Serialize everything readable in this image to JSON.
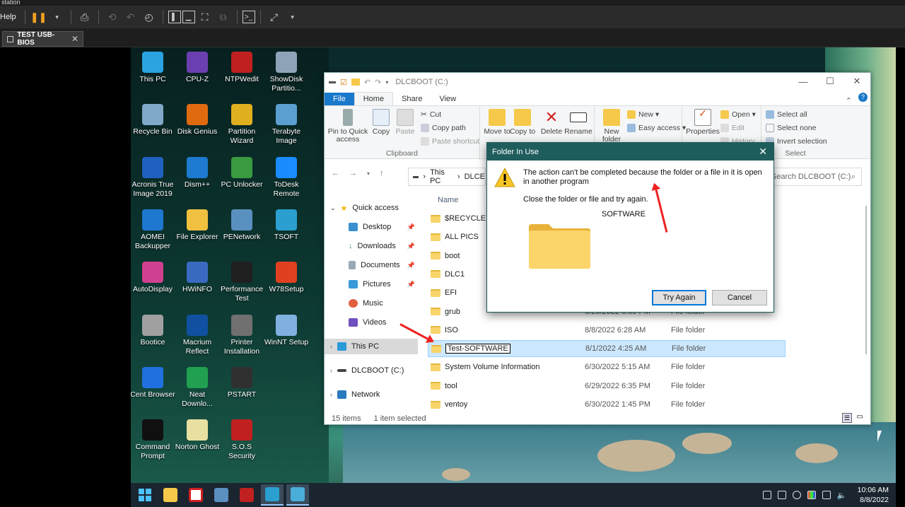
{
  "host": {
    "title_fragment": "station",
    "menu_help": "Help",
    "vm_tab": "TEST USB-BIOS",
    "vm_tab_close": "✕"
  },
  "desktop_icons": [
    {
      "label": "This PC",
      "icon": "monitor-icon",
      "color": "#2aa3e0"
    },
    {
      "label": "CPU-Z",
      "icon": "chip-icon",
      "color": "#6b3fb0"
    },
    {
      "label": "NTPWedit",
      "icon": "ntpw-icon",
      "color": "#c02020"
    },
    {
      "label": "ShowDisk Partitio...",
      "icon": "disk-search-icon",
      "color": "#8fa3b8"
    },
    {
      "label": "Recycle Bin",
      "icon": "recycle-bin-icon",
      "color": "#7fa8c9"
    },
    {
      "label": "Disk Genius",
      "icon": "diskgenius-icon",
      "color": "#e06a10"
    },
    {
      "label": "Partition Wizard",
      "icon": "partition-wizard-icon",
      "color": "#e0b020"
    },
    {
      "label": "Terabyte Image",
      "icon": "terabyte-icon",
      "color": "#5a9fd0"
    },
    {
      "label": "Acronis True Image 2019",
      "icon": "acronis-icon",
      "color": "#2060c0"
    },
    {
      "label": "Dism++",
      "icon": "gears-icon",
      "color": "#1e7ad0"
    },
    {
      "label": "PC Unlocker",
      "icon": "pc-unlocker-icon",
      "color": "#3a9a40"
    },
    {
      "label": "ToDesk Remote",
      "icon": "todesk-icon",
      "color": "#1a8cff"
    },
    {
      "label": "AOMEI Backupper",
      "icon": "aomei-icon",
      "color": "#1e78d0"
    },
    {
      "label": "File Explorer",
      "icon": "folder-icon",
      "color": "#f0c040"
    },
    {
      "label": "PENetwork",
      "icon": "network-icon",
      "color": "#5a90c0"
    },
    {
      "label": "TSOFT",
      "icon": "tsoft-icon",
      "color": "#2a9fd0"
    },
    {
      "label": "AutoDisplay",
      "icon": "display-icon",
      "color": "#d04090"
    },
    {
      "label": "HWiNFO",
      "icon": "hwinfo-icon",
      "color": "#3a6ac0"
    },
    {
      "label": "Performance Test",
      "icon": "performance-icon",
      "color": "#202020"
    },
    {
      "label": "W78Setup",
      "icon": "windows-setup-icon",
      "color": "#e04020"
    },
    {
      "label": "Bootice",
      "icon": "bootice-icon",
      "color": "#a0a0a0"
    },
    {
      "label": "Macrium Reflect",
      "icon": "macrium-icon",
      "color": "#1050a0"
    },
    {
      "label": "Printer Installation",
      "icon": "printer-icon",
      "color": "#707070"
    },
    {
      "label": "WinNT Setup",
      "icon": "winnt-icon",
      "color": "#80b0e0"
    },
    {
      "label": "Cent Browser",
      "icon": "browser-icon",
      "color": "#2070e0"
    },
    {
      "label": "Neat Downlo...",
      "icon": "neat-download-icon",
      "color": "#20a050"
    },
    {
      "label": "PSTART",
      "icon": "play-icon",
      "color": "#303030"
    },
    {
      "label": "",
      "icon": "",
      "color": ""
    },
    {
      "label": "Command Prompt",
      "icon": "cmd-icon",
      "color": "#101010"
    },
    {
      "label": "Norton Ghost",
      "icon": "ghost-icon",
      "color": "#e8e0a0"
    },
    {
      "label": "S.O.S Security",
      "icon": "sos-icon",
      "color": "#c02020"
    }
  ],
  "explorer": {
    "title": "DLCBOOT (C:)",
    "tabs": [
      "File",
      "Home",
      "Share",
      "View"
    ],
    "ribbon": {
      "pin_label": "Pin to Quick access",
      "copy_label": "Copy",
      "paste_label": "Paste",
      "cut_label": "Cut",
      "copy_path_label": "Copy path",
      "paste_shortcut_label": "Paste shortcut",
      "clipboard_group": "Clipboard",
      "move_to_label": "Move to",
      "copy_to_label": "Copy to",
      "delete_label": "Delete",
      "rename_label": "Rename",
      "new_folder_label": "New folder",
      "new_item_label": "New ▾",
      "easy_access_label": "Easy access ▾",
      "properties_label": "Properties",
      "open_label": "Open ▾",
      "edit_label": "Edit",
      "history_label": "History",
      "select_all_label": "Select all",
      "select_none_label": "Select none",
      "invert_label": "Invert selection",
      "select_group": "Select"
    },
    "address": [
      "This PC",
      "DLCE"
    ],
    "search_placeholder": "Search DLCBOOT (C:)",
    "nav": {
      "quick_access": "Quick access",
      "desktop": "Desktop",
      "downloads": "Downloads",
      "documents": "Documents",
      "pictures": "Pictures",
      "music": "Music",
      "videos": "Videos",
      "this_pc": "This PC",
      "dlcboot": "DLCBOOT (C:)",
      "network": "Network"
    },
    "column_name": "Name",
    "files": [
      {
        "name": "$RECYCLE.BIN",
        "date": "",
        "type": ""
      },
      {
        "name": "ALL PICS",
        "date": "",
        "type": ""
      },
      {
        "name": "boot",
        "date": "",
        "type": ""
      },
      {
        "name": "DLC1",
        "date": "",
        "type": ""
      },
      {
        "name": "EFI",
        "date": "",
        "type": ""
      },
      {
        "name": "grub",
        "date": "6/29/2022 6:09 PM",
        "type": "File folder"
      },
      {
        "name": "ISO",
        "date": "8/8/2022 6:28 AM",
        "type": "File folder"
      },
      {
        "name": "Test-SOFTWARE",
        "date": "8/1/2022 4:25 AM",
        "type": "File folder"
      },
      {
        "name": "System Volume Information",
        "date": "6/30/2022 5:15 AM",
        "type": "File folder"
      },
      {
        "name": "tool",
        "date": "6/29/2022 6:35 PM",
        "type": "File folder"
      },
      {
        "name": "ventoy",
        "date": "6/30/2022 1:45 PM",
        "type": "File folder"
      }
    ],
    "status_items": "15 items",
    "status_selected": "1 item selected"
  },
  "dialog": {
    "title": "Folder In Use",
    "message": "The action can't be completed because the folder or a file in it is open in another program",
    "instruction": "Close the folder or file and try again.",
    "folder_name": "SOFTWARE",
    "try_again": "Try Again",
    "cancel": "Cancel"
  },
  "taskbar": {
    "time": "10:06 AM",
    "date": "8/8/2022"
  }
}
